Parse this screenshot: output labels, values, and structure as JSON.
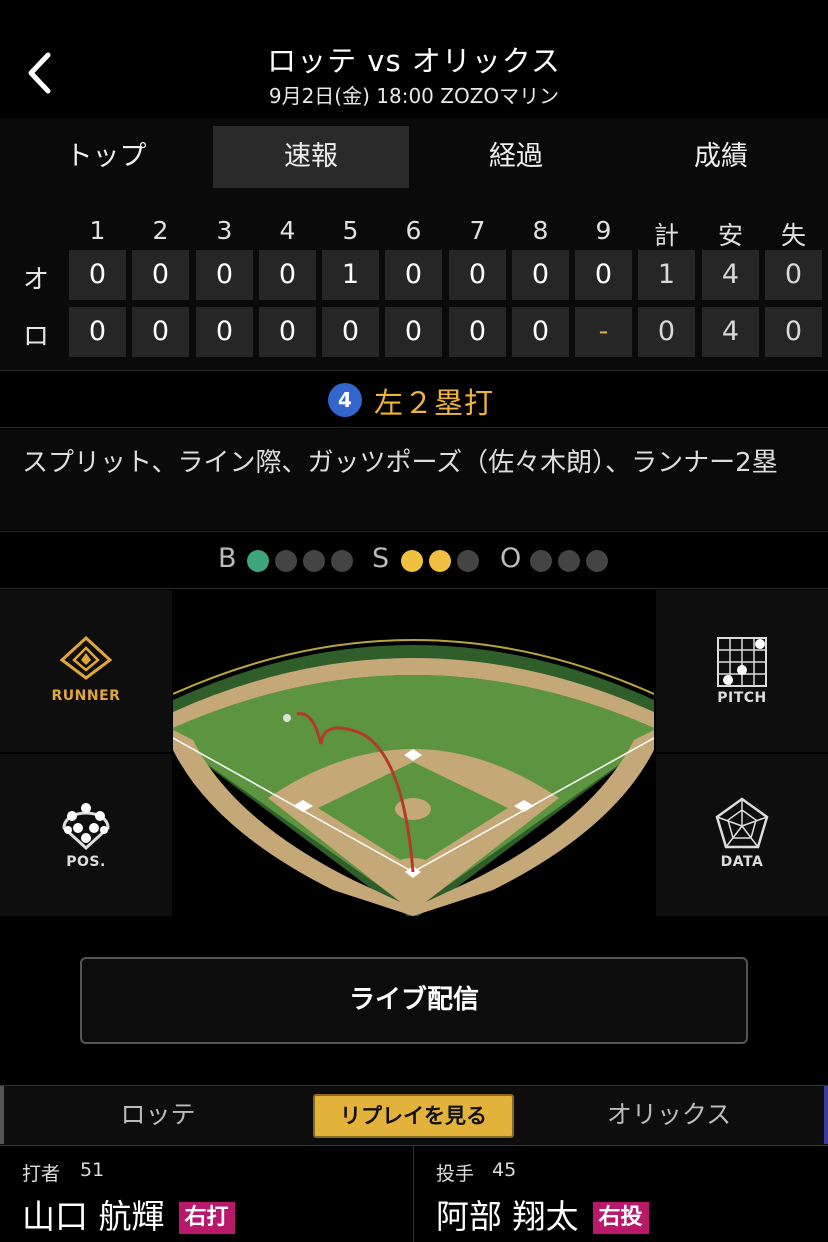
{
  "header": {
    "title": "ロッテ vs オリックス",
    "subtitle": "9月2日(金) 18:00 ZOZOマリン"
  },
  "tabs": [
    "トップ",
    "速報",
    "経過",
    "成績"
  ],
  "active_tab": 1,
  "scoreboard": {
    "headers": [
      "1",
      "2",
      "3",
      "4",
      "5",
      "6",
      "7",
      "8",
      "9",
      "計",
      "安",
      "失"
    ],
    "rows": [
      {
        "team": "オ",
        "cells": [
          "0",
          "0",
          "0",
          "0",
          "1",
          "0",
          "0",
          "0",
          "0",
          "1",
          "4",
          "0"
        ]
      },
      {
        "team": "ロ",
        "cells": [
          "0",
          "0",
          "0",
          "0",
          "0",
          "0",
          "0",
          "0",
          "-",
          "0",
          "4",
          "0"
        ]
      }
    ]
  },
  "play": {
    "number": "4",
    "result": "左２塁打",
    "description": "スプリット、ライン際、ガッツポーズ（佐々木朗）、ランナー2塁"
  },
  "count": {
    "ball_label": "B",
    "strike_label": "S",
    "out_label": "O",
    "balls": 1,
    "strikes": 2,
    "outs": 0,
    "ball_max": 4,
    "strike_max": 3,
    "out_max": 3
  },
  "side_buttons": {
    "runner": "RUNNER",
    "pitch": "PITCH",
    "pos": "POS.",
    "data": "DATA"
  },
  "live_button": "ライブ配信",
  "bottom_tabs": {
    "left": "ロッテ",
    "replay": "リプレイを見る",
    "right": "オリックス"
  },
  "batter": {
    "role": "打者",
    "number": "51",
    "name": "山口 航輝",
    "badge": "右打"
  },
  "pitcher": {
    "role": "投手",
    "number": "45",
    "name": "阿部 翔太",
    "badge": "右投"
  },
  "colors": {
    "ball": "#3fa57a",
    "strike": "#f0c040",
    "play_text": "#f0b43a",
    "badge": "#b8196a",
    "replay": "#e2b23a"
  }
}
